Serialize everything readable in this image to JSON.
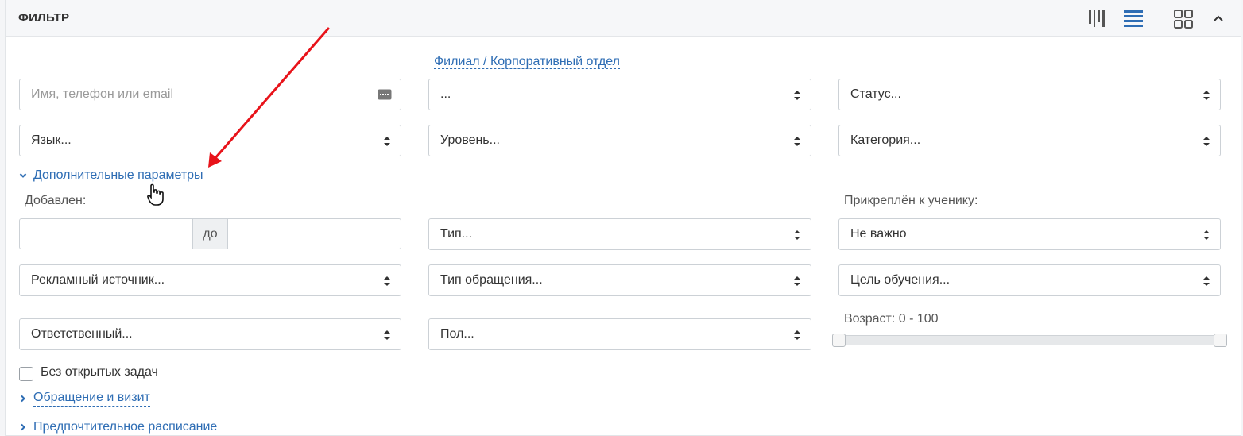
{
  "header": {
    "title": "ФИЛЬТР",
    "buttons": [
      {
        "icon": "columns-view-icon",
        "active": false
      },
      {
        "icon": "list-view-icon",
        "active": true
      },
      {
        "icon": "grid-view-icon",
        "active": false
      },
      {
        "icon": "chevron-up-icon",
        "active": false
      }
    ]
  },
  "branch_link": "Филиал / Корпоративный отдел",
  "row1": {
    "search_placeholder": "Имя, телефон или email",
    "branch_select": "...",
    "status_select": "Статус..."
  },
  "row2": {
    "language_select": "Язык...",
    "level_select": "Уровень...",
    "category_select": "Категория..."
  },
  "advanced_toggle": "Дополнительные параметры",
  "added": {
    "label": "Добавлен:",
    "from_value": "",
    "to_label": "до",
    "to_value": ""
  },
  "attached_label": "Прикреплён к ученику:",
  "row3": {
    "type_select": "Тип...",
    "attached_select": "Не важно"
  },
  "row4": {
    "ad_source_select": "Рекламный источник...",
    "request_type_select": "Тип обращения...",
    "goal_select": "Цель обучения..."
  },
  "row5": {
    "responsible_select": "Ответственный...",
    "gender_select": "Пол...",
    "age_label": "Возраст: 0 - 100",
    "age_min": 0,
    "age_max": 100
  },
  "no_open_tasks_label": "Без открытых задач",
  "no_open_tasks_checked": false,
  "collapsibles": {
    "request_visit": "Обращение и визит",
    "preferred_schedule": "Предпочтительное расписание"
  },
  "colors": {
    "link": "#2e6db4",
    "active_icon": "#2e6db4",
    "annotation_arrow": "#e8131a"
  }
}
